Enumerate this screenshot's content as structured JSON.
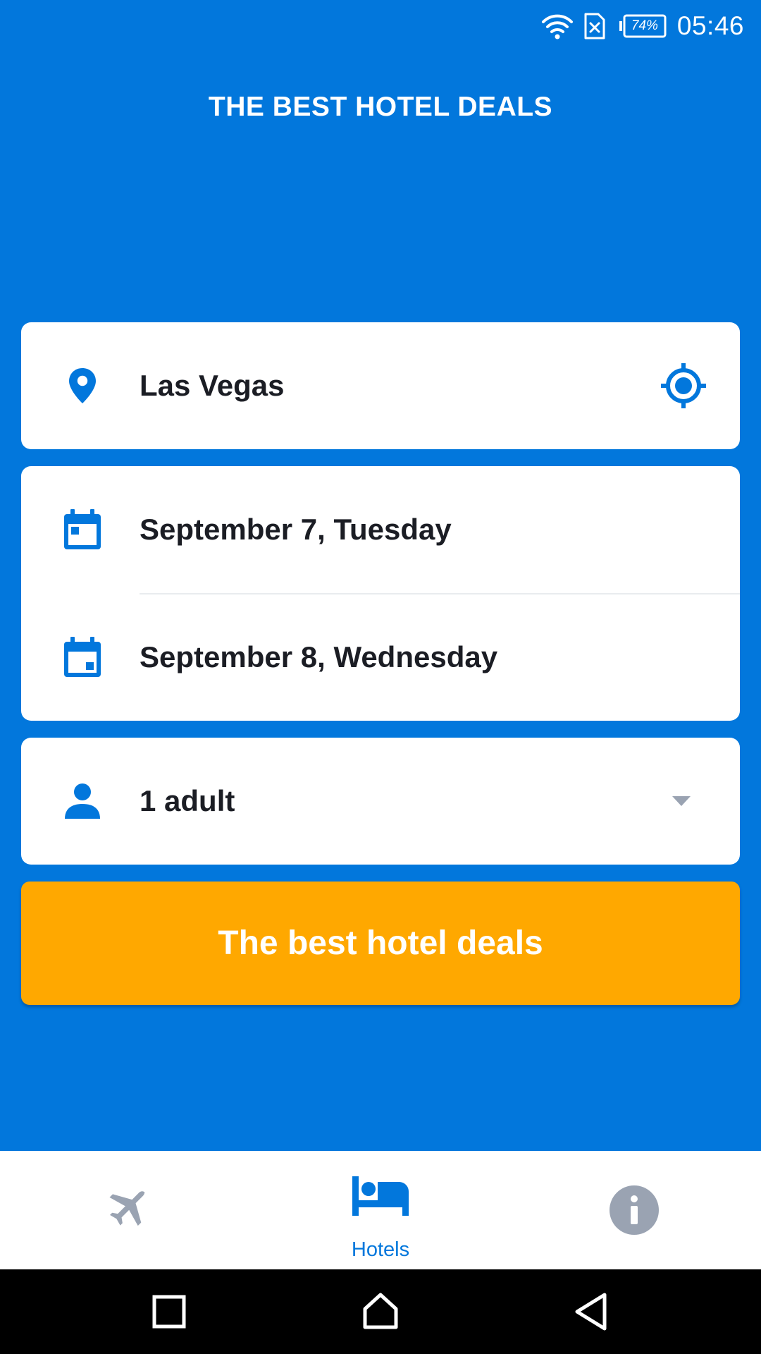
{
  "status_bar": {
    "battery_percent": "74%",
    "time": "05:46",
    "icons": [
      "wifi-icon",
      "no-sim-icon",
      "battery-icon"
    ]
  },
  "app_title": "THE BEST HOTEL DEALS",
  "search_form": {
    "destination": {
      "value": "Las Vegas",
      "icon": "location-pin-icon",
      "action_icon": "current-location-icon"
    },
    "dates": {
      "check_in": "September 7, Tuesday",
      "check_out": "September 8, Wednesday",
      "check_in_icon": "calendar-checkin-icon",
      "check_out_icon": "calendar-checkout-icon"
    },
    "guests": {
      "value": "1 adult",
      "icon": "person-icon",
      "dropdown_icon": "dropdown-arrow-icon"
    },
    "submit_label": "The best hotel deals"
  },
  "bottom_nav": {
    "items": [
      {
        "icon": "airplane-icon",
        "label": "",
        "active": false
      },
      {
        "icon": "bed-icon",
        "label": "Hotels",
        "active": true
      },
      {
        "icon": "info-icon",
        "label": "",
        "active": false
      }
    ]
  },
  "system_nav": {
    "buttons": [
      "recents-button",
      "home-button",
      "back-button"
    ]
  },
  "colors": {
    "primary_blue": "#0277DC",
    "cta_orange": "#FFA800",
    "inactive_gray": "#9AA3B2",
    "text_dark": "#1b1d24"
  }
}
